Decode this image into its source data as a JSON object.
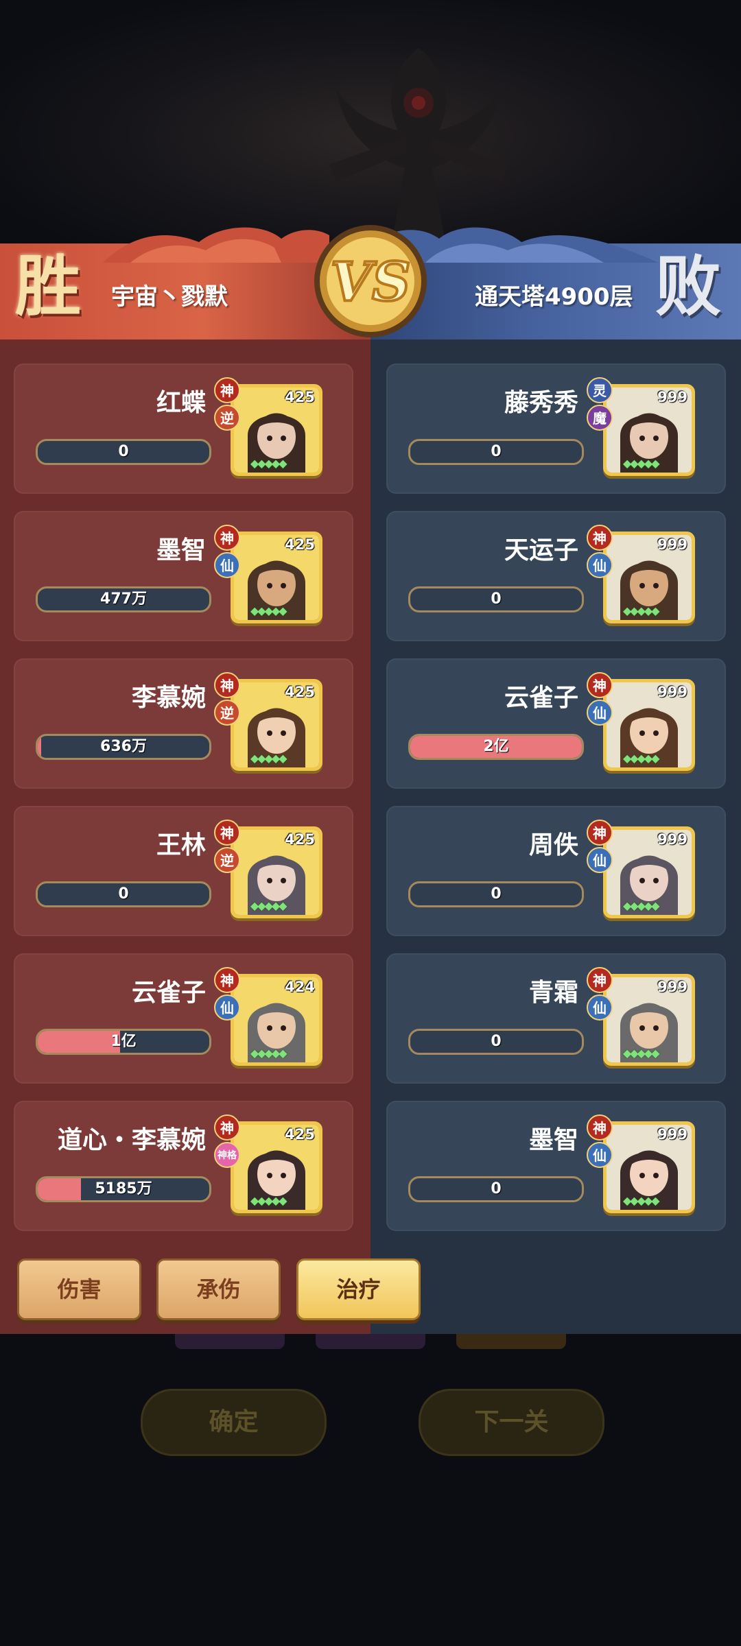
{
  "header": {
    "win_label": "胜",
    "lose_label": "败",
    "left_name": "宇宙丶戮默",
    "right_name": "通天塔4900层",
    "vs_label": "VS"
  },
  "left_team": [
    {
      "name": "红蝶",
      "level": "425",
      "badges": [
        "神",
        "逆"
      ],
      "value": "0",
      "fill": 0
    },
    {
      "name": "墨智",
      "level": "425",
      "badges": [
        "神",
        "仙"
      ],
      "value": "477万",
      "fill": 0.0
    },
    {
      "name": "李慕婉",
      "level": "425",
      "badges": [
        "神",
        "逆"
      ],
      "value": "636万",
      "fill": 0.02
    },
    {
      "name": "王林",
      "level": "425",
      "badges": [
        "神",
        "逆"
      ],
      "value": "0",
      "fill": 0
    },
    {
      "name": "云雀子",
      "level": "424",
      "badges": [
        "神",
        "仙"
      ],
      "value": "1亿",
      "fill": 0.48
    },
    {
      "name": "道心・李慕婉",
      "level": "425",
      "badges": [
        "神",
        "神格"
      ],
      "value": "5185万",
      "fill": 0.25
    }
  ],
  "right_team": [
    {
      "name": "藤秀秀",
      "level": "999",
      "badges": [
        "灵",
        "魔"
      ],
      "value": "0",
      "fill": 0
    },
    {
      "name": "天运子",
      "level": "999",
      "badges": [
        "神",
        "仙"
      ],
      "value": "0",
      "fill": 0
    },
    {
      "name": "云雀子",
      "level": "999",
      "badges": [
        "神",
        "仙"
      ],
      "value": "2亿",
      "fill": 1.0
    },
    {
      "name": "周佚",
      "level": "999",
      "badges": [
        "神",
        "仙"
      ],
      "value": "0",
      "fill": 0
    },
    {
      "name": "青霜",
      "level": "999",
      "badges": [
        "神",
        "仙"
      ],
      "value": "0",
      "fill": 0
    },
    {
      "name": "墨智",
      "level": "999",
      "badges": [
        "神",
        "仙"
      ],
      "value": "0",
      "fill": 0
    }
  ],
  "tabs": [
    {
      "label": "伤害",
      "active": false
    },
    {
      "label": "承伤",
      "active": false
    },
    {
      "label": "治疗",
      "active": true
    }
  ],
  "background_buttons": {
    "confirm": "确定",
    "next": "下一关"
  },
  "colors": {
    "win_red": "#c9503a",
    "lose_blue": "#46629e",
    "bar_fill": "#e9777c",
    "frame_gold": "#f1c74b"
  }
}
